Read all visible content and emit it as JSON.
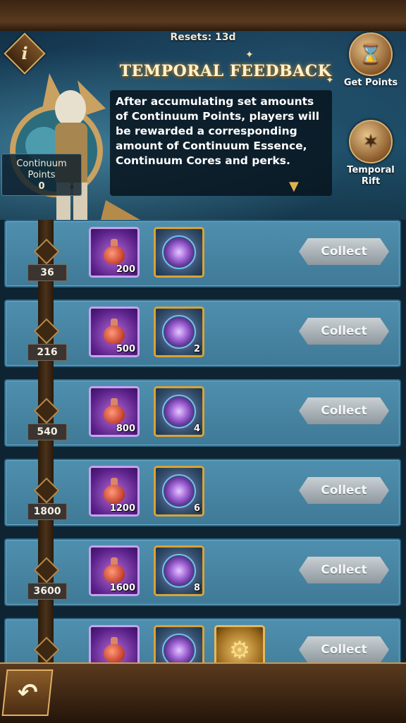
{
  "header": {
    "resets": "Resets: 13d",
    "title": "TEMPORAL FEEDBACK",
    "info_icon": "i"
  },
  "continuum": {
    "label": "Continuum Points",
    "value": "0"
  },
  "description": "After accumulating set amounts of Continuum Points, players will be rewarded a corresponding amount of Continuum Essence, Continuum Cores and perks.",
  "side_buttons": {
    "get_points": "Get Points",
    "temporal_rift": "Temporal Rift"
  },
  "rows": [
    {
      "threshold": "36",
      "essence": "200",
      "cores": "",
      "collect": "Collect"
    },
    {
      "threshold": "216",
      "essence": "500",
      "cores": "2",
      "collect": "Collect"
    },
    {
      "threshold": "540",
      "essence": "800",
      "cores": "4",
      "collect": "Collect"
    },
    {
      "threshold": "1800",
      "essence": "1200",
      "cores": "6",
      "collect": "Collect"
    },
    {
      "threshold": "3600",
      "essence": "1600",
      "cores": "8",
      "collect": "Collect"
    },
    {
      "threshold": "",
      "essence": "",
      "cores": "",
      "collect": "Collect"
    }
  ],
  "colors": {
    "row_bg": "#4f8fae",
    "wood": "#5a3a1e",
    "gold": "#d9a238",
    "essence_purple": "#5a2189"
  }
}
